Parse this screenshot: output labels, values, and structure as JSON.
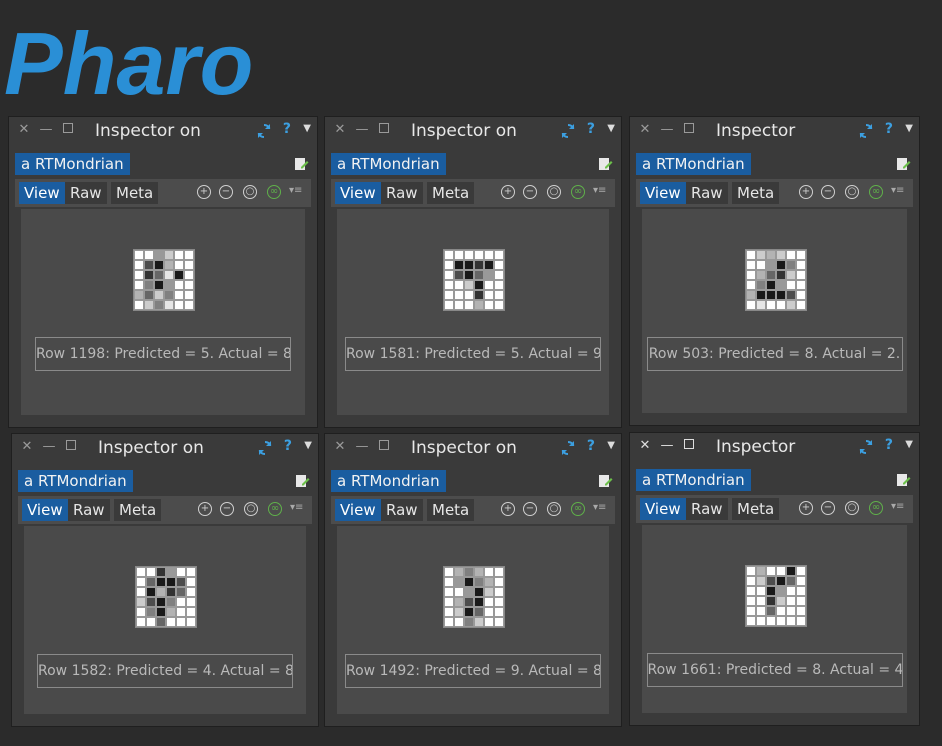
{
  "logo": {
    "text": "Pharo"
  },
  "colors": {
    "accent": "#1a5da0",
    "logo_blue": "#2a8fd6",
    "help_blue": "#3c9fe0"
  },
  "tabs": {
    "view": "View",
    "raw": "Raw",
    "meta": "Meta"
  },
  "windows": [
    {
      "title": "Inspector on",
      "object": "a RTMondrian",
      "label": "Row 1198: Predicted = 5. Actual = 8.",
      "pixels": [
        [
          0,
          0,
          0.4,
          0.2,
          0,
          0
        ],
        [
          0,
          0.7,
          0.9,
          0.3,
          0,
          0
        ],
        [
          0,
          0.8,
          0.6,
          0.1,
          0.9,
          0
        ],
        [
          0,
          0.5,
          0.9,
          0.4,
          0,
          0
        ],
        [
          0.3,
          0.6,
          0.2,
          0.5,
          0,
          0
        ],
        [
          0,
          0.2,
          0.5,
          0.1,
          0,
          0
        ]
      ]
    },
    {
      "title": "Inspector on",
      "object": "a RTMondrian",
      "label": "Row 1581: Predicted = 5. Actual = 9.",
      "pixels": [
        [
          0,
          0,
          0,
          0,
          0,
          0
        ],
        [
          0,
          0.9,
          0.9,
          0.8,
          0.9,
          0
        ],
        [
          0,
          0.7,
          0.9,
          0.6,
          0.4,
          0
        ],
        [
          0,
          0,
          0.2,
          0.9,
          0,
          0
        ],
        [
          0,
          0,
          0,
          0.8,
          0,
          0
        ],
        [
          0,
          0,
          0,
          0.3,
          0,
          0
        ]
      ]
    },
    {
      "title": "Inspector",
      "object": "a RTMondrian",
      "label": "Row 503: Predicted = 8. Actual = 2.",
      "pixels": [
        [
          0,
          0.2,
          0.3,
          0.2,
          0,
          0
        ],
        [
          0,
          0,
          0.4,
          0.9,
          0.5,
          0
        ],
        [
          0,
          0.3,
          0.6,
          0.8,
          0.2,
          0
        ],
        [
          0,
          0.5,
          0.9,
          0.4,
          0,
          0
        ],
        [
          0.3,
          0.9,
          0.9,
          0.9,
          0.7,
          0
        ],
        [
          0,
          0.1,
          0,
          0,
          0.2,
          0
        ]
      ]
    },
    {
      "title": "Inspector on",
      "object": "a RTMondrian",
      "label": "Row 1582: Predicted = 4. Actual = 8.",
      "pixels": [
        [
          0,
          0,
          0.8,
          0.4,
          0,
          0
        ],
        [
          0,
          0.6,
          0.9,
          0.9,
          0.7,
          0
        ],
        [
          0,
          0.9,
          0.3,
          0.8,
          0.6,
          0
        ],
        [
          0.2,
          0.7,
          0.9,
          0.5,
          0,
          0
        ],
        [
          0,
          0.5,
          0.9,
          0.3,
          0,
          0
        ],
        [
          0,
          0,
          0.6,
          0,
          0,
          0
        ]
      ]
    },
    {
      "title": "Inspector on",
      "object": "a RTMondrian",
      "label": "Row 1492: Predicted = 9. Actual = 8.",
      "pixels": [
        [
          0,
          0.3,
          0.5,
          0.3,
          0,
          0
        ],
        [
          0,
          0.4,
          0.9,
          0.5,
          0.3,
          0
        ],
        [
          0,
          0,
          0.4,
          0.9,
          0.2,
          0
        ],
        [
          0,
          0.3,
          0.7,
          0.9,
          0,
          0
        ],
        [
          0,
          0.2,
          0.9,
          0.6,
          0,
          0
        ],
        [
          0,
          0,
          0.5,
          0.2,
          0,
          0
        ]
      ]
    },
    {
      "title": "Inspector",
      "object": "a RTMondrian",
      "label": "Row 1661: Predicted = 8. Actual = 4.",
      "pixels": [
        [
          0,
          0.3,
          0,
          0,
          0.9,
          0
        ],
        [
          0,
          0.2,
          0.7,
          0.9,
          0.6,
          0
        ],
        [
          0,
          0,
          0.9,
          0.4,
          0,
          0
        ],
        [
          0,
          0,
          0.8,
          0.2,
          0,
          0
        ],
        [
          0,
          0,
          0.6,
          0,
          0,
          0
        ],
        [
          0,
          0,
          0,
          0,
          0,
          0
        ]
      ]
    }
  ]
}
